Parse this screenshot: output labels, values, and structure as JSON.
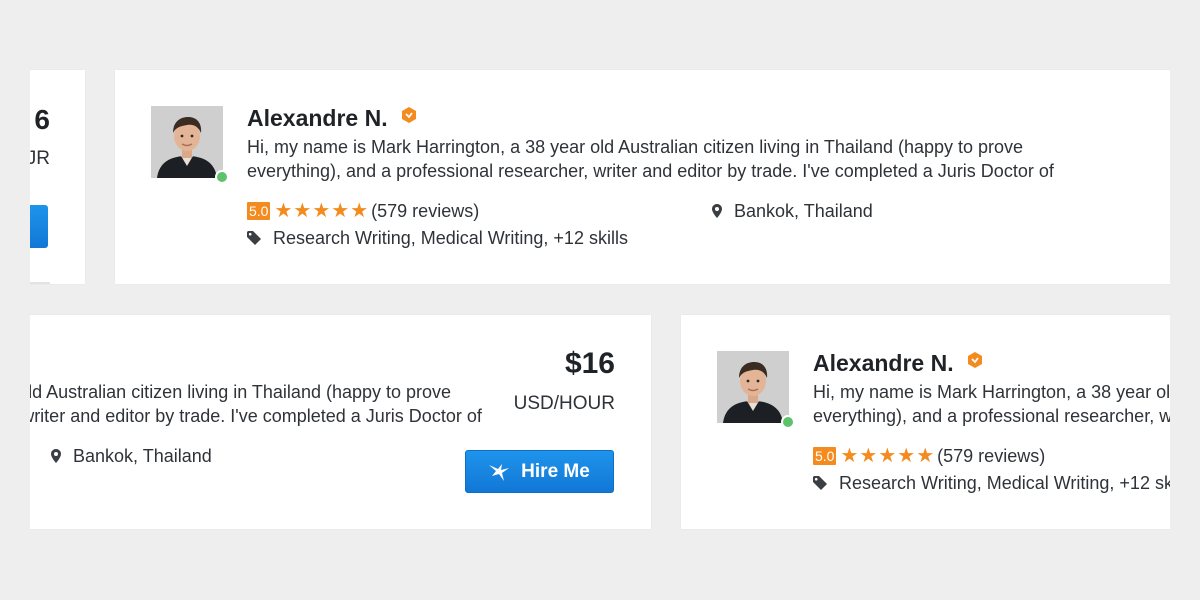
{
  "freelancer": {
    "name": "Alexandre N.",
    "bio_line1": "Hi, my name is Mark Harrington, a 38 year old Australian citizen living in Thailand (happy to prove",
    "bio_line2": "everything), and a professional researcher, writer and editor by trade. I've completed a Juris Doctor of",
    "rating": "5.0",
    "stars_filled": 5,
    "stars_total": 5,
    "reviews": "(579 reviews)",
    "location": "Bankok, Thailand",
    "skills": "Research Writing, Medical Writing, +12 skills",
    "price": "$16",
    "price_unit": "USD/HOUR",
    "hire_label": "Hire Me",
    "left_edge_price": "6",
    "left_edge_unit": "JR"
  },
  "icons": {
    "verified_badge": "verified-badge-icon",
    "location": "map-pin-icon",
    "skills": "tag-icon",
    "hire": "bird-icon"
  },
  "colors": {
    "background": "#eeeeee",
    "accent_orange": "#f38b1f",
    "button_blue": "#1a86e3",
    "online_green": "#5dc26a"
  }
}
